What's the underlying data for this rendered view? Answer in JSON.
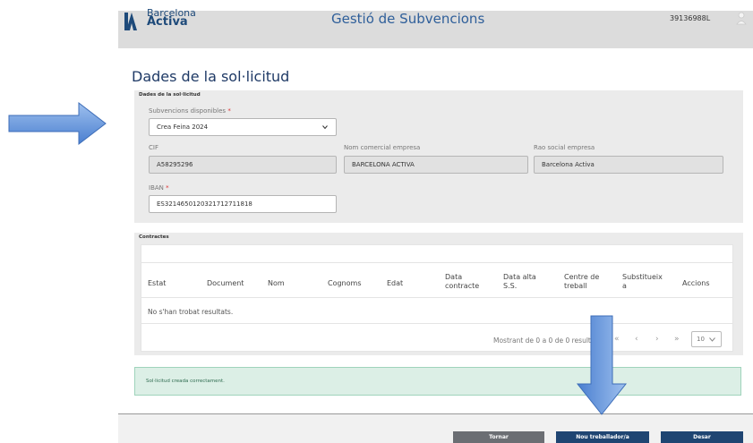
{
  "header": {
    "logo_line1": "Barcelona",
    "logo_line2": "Activa",
    "app_title": "Gestió de Subvencions",
    "user_id": "39136988L"
  },
  "page": {
    "title": "Dades de la sol·licitud"
  },
  "request_section": {
    "label": "Dades de la sol·licitud",
    "subvencions": {
      "label": "Subvencions disponibles",
      "required_mark": "*",
      "value": "Crea Feina 2024"
    },
    "cif": {
      "label": "CIF",
      "value": "A58295296"
    },
    "nom_comercial": {
      "label": "Nom comercial empresa",
      "value": "BARCELONA ACTIVA"
    },
    "rao_social": {
      "label": "Rao social empresa",
      "value": "Barcelona Activa"
    },
    "iban": {
      "label": "IBAN",
      "required_mark": "*",
      "value": "ES3214650120321712711818"
    }
  },
  "contracts_section": {
    "label": "Contractes",
    "columns": [
      {
        "line1": "Estat",
        "line2": ""
      },
      {
        "line1": "Document",
        "line2": ""
      },
      {
        "line1": "Nom",
        "line2": ""
      },
      {
        "line1": "Cognoms",
        "line2": ""
      },
      {
        "line1": "Edat",
        "line2": ""
      },
      {
        "line1": "Data",
        "line2": "contracte"
      },
      {
        "line1": "Data alta",
        "line2": "S.S."
      },
      {
        "line1": "Centre de",
        "line2": "treball"
      },
      {
        "line1": "Substitueix",
        "line2": "a"
      },
      {
        "line1": "Accions",
        "line2": ""
      }
    ],
    "empty_text": "No s'han trobat resultats.",
    "pager_text": "Mostrant de 0 a 0 de 0 resultats",
    "pager_first": "«",
    "pager_prev": "‹",
    "pager_next": "›",
    "pager_last": "»",
    "page_size": "10"
  },
  "alert": {
    "text": "Sol·licitud creada correctament."
  },
  "footer": {
    "tornar": "Tornar",
    "nou_treballador": "Nou treballador/a",
    "desar": "Desar"
  },
  "colors": {
    "primary_dark": "#1f3a66",
    "footer_grey_button": "#6b6e73",
    "footer_blue_button": "#1f4572",
    "alert_bg": "#dcefe6",
    "arrow_blue": "#5b8fd9"
  },
  "icons": {
    "logo": "barcelona-activa-logo-icon",
    "user": "user-icon",
    "dropdown": "chevron-down-icon"
  }
}
